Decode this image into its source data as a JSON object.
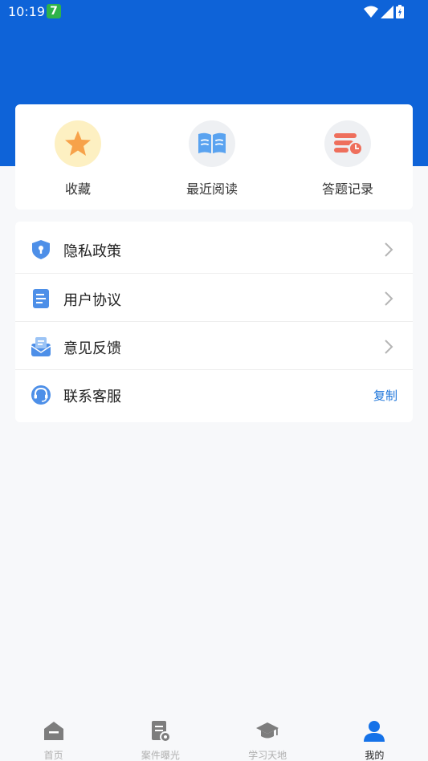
{
  "status_bar": {
    "time": "10:19",
    "app_badge": "7"
  },
  "quick_actions": [
    {
      "label": "收藏",
      "icon": "star-icon",
      "bg": "#fdf0c2",
      "color": "#f7a24a"
    },
    {
      "label": "最近阅读",
      "icon": "open-book-icon",
      "bg": "#eef0f3",
      "color": "#5aa3f0"
    },
    {
      "label": "答题记录",
      "icon": "record-clock-icon",
      "bg": "#eef0f3",
      "color": "#ee6f5c"
    }
  ],
  "menu": [
    {
      "label": "隐私政策",
      "icon": "shield-icon"
    },
    {
      "label": "用户协议",
      "icon": "document-icon"
    },
    {
      "label": "意见反馈",
      "icon": "feedback-mail-icon"
    },
    {
      "label": "联系客服",
      "icon": "headset-icon",
      "action": "复制"
    }
  ],
  "tabs": [
    {
      "label": "首页",
      "icon": "home-icon",
      "active": false
    },
    {
      "label": "案件曝光",
      "icon": "case-exposure-icon",
      "active": false
    },
    {
      "label": "学习天地",
      "icon": "graduation-cap-icon",
      "active": false
    },
    {
      "label": "我的",
      "icon": "user-icon",
      "active": true
    }
  ],
  "colors": {
    "header_blue": "#0e63d8",
    "link_blue": "#1a73d9",
    "active_tab": "#1572e8"
  }
}
